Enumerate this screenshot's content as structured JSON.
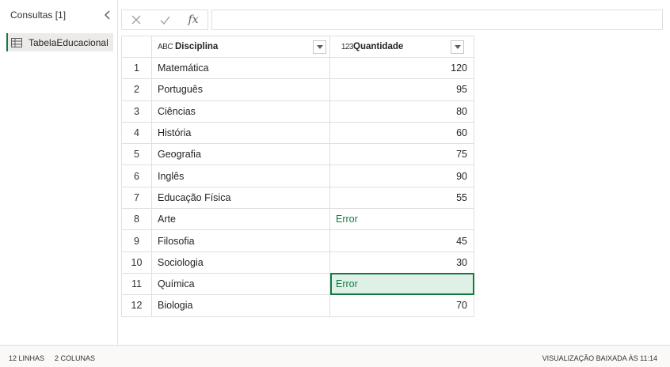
{
  "sidebar": {
    "header": "Consultas [1]",
    "queries": [
      {
        "label": "TabelaEducacional"
      }
    ]
  },
  "formula_bar": {
    "value": ""
  },
  "table": {
    "columns": [
      {
        "type_label": "ABC",
        "name": "Disciplina"
      },
      {
        "type_label": "123",
        "name": "Quantidade"
      }
    ],
    "rows": [
      {
        "index": "1",
        "disciplina": "Matemática",
        "quantidade": "120"
      },
      {
        "index": "2",
        "disciplina": "Português",
        "quantidade": "95"
      },
      {
        "index": "3",
        "disciplina": "Ciências",
        "quantidade": "80"
      },
      {
        "index": "4",
        "disciplina": "História",
        "quantidade": "60"
      },
      {
        "index": "5",
        "disciplina": "Geografia",
        "quantidade": "75"
      },
      {
        "index": "6",
        "disciplina": "Inglês",
        "quantidade": "90"
      },
      {
        "index": "7",
        "disciplina": "Educação Física",
        "quantidade": "55"
      },
      {
        "index": "8",
        "disciplina": "Arte",
        "quantidade": "Error"
      },
      {
        "index": "9",
        "disciplina": "Filosofia",
        "quantidade": "45"
      },
      {
        "index": "10",
        "disciplina": "Sociologia",
        "quantidade": "30"
      },
      {
        "index": "11",
        "disciplina": "Química",
        "quantidade": "Error"
      },
      {
        "index": "12",
        "disciplina": "Biologia",
        "quantidade": "70"
      }
    ],
    "selected_row": 11
  },
  "status": {
    "rows": "12 LINHAS",
    "columns": "2 COLUNAS",
    "preview": "VISUALIZAÇÃO BAIXADA ÀS 11:14"
  },
  "colors": {
    "accent": "#107c41",
    "error_text": "#107c41",
    "selection_fill": "#dff0e6"
  }
}
